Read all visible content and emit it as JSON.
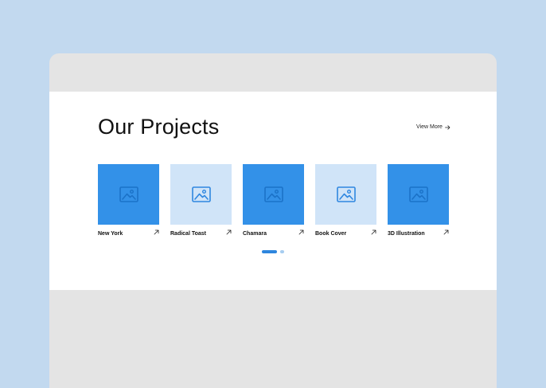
{
  "section": {
    "title": "Our Projects",
    "view_more_label": "View More"
  },
  "projects": [
    {
      "title": "New York",
      "style": "dark",
      "icon": "image-placeholder-icon"
    },
    {
      "title": "Radical Toast",
      "style": "light",
      "icon": "image-placeholder-icon"
    },
    {
      "title": "Chamara",
      "style": "dark",
      "icon": "image-placeholder-icon"
    },
    {
      "title": "Book Cover",
      "style": "light",
      "icon": "image-placeholder-icon"
    },
    {
      "title": "3D Illustration",
      "style": "dark",
      "icon": "image-placeholder-icon"
    }
  ],
  "pagination": {
    "pages": 2,
    "active_page": 1
  },
  "colors": {
    "background": "#c2d9ef",
    "window_chrome": "#e4e4e4",
    "panel": "#ffffff",
    "card_dark": "#3391e8",
    "card_light": "#d0e4f8",
    "icon_on_dark": "#1b72c8",
    "icon_on_light": "#2f87e0",
    "dot_active": "#2e86de",
    "dot_inactive": "#a7cdf0",
    "text": "#111111"
  }
}
